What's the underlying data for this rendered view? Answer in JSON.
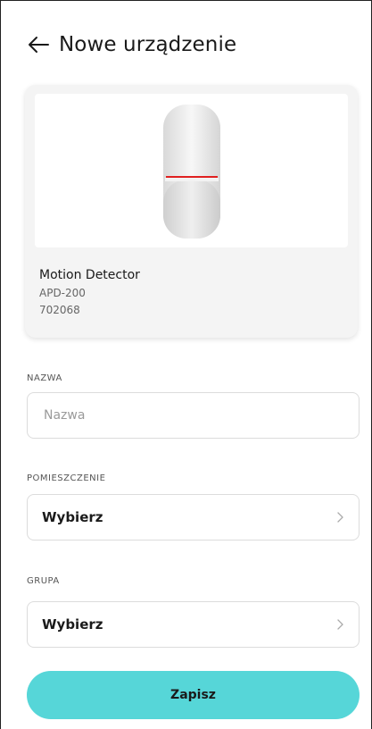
{
  "header": {
    "back_icon": "arrow-left-icon",
    "title": "Nowe urządzenie"
  },
  "device": {
    "image_icon": "motion-detector-image",
    "name": "Motion Detector",
    "model": "APD-200",
    "code": "702068",
    "indicator_color": "#e02020"
  },
  "form": {
    "name_label": "NAZWA",
    "name_placeholder": "Nazwa",
    "name_value": "",
    "room_label": "POMIESZCZENIE",
    "room_value": "Wybierz",
    "group_label": "GRUPA",
    "group_value": "Wybierz",
    "chevron_icon": "chevron-right-icon"
  },
  "actions": {
    "save_label": "Zapisz",
    "save_color": "#56d6d8"
  }
}
